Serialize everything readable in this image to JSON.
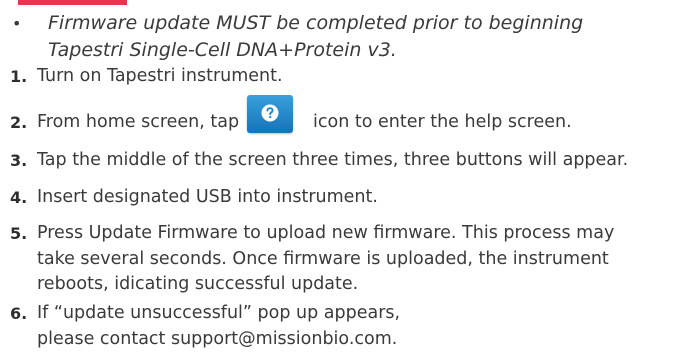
{
  "note": {
    "bullet": "•",
    "text": "Firmware update MUST be completed prior to beginning\nTapestri Single-Cell DNA+Protein v3."
  },
  "steps": [
    {
      "num": "1.",
      "text": "Turn on Tapestri instrument."
    },
    {
      "num": "2.",
      "text_before": "From home screen, tap",
      "icon": "help-question-icon",
      "text_after": "icon to enter the help screen."
    },
    {
      "num": "3.",
      "text": "Tap the middle of the screen three times, three buttons will appear."
    },
    {
      "num": "4.",
      "text": "Insert designated USB into instrument."
    },
    {
      "num": "5.",
      "text": "Press Update Firmware to upload new firmware. This process may\ntake several seconds. Once firmware is uploaded, the instrument\nreboots, idicating successful update."
    },
    {
      "num": "6.",
      "text": "If “update unsuccessful” pop up appears,\nplease contact support@missionbio.com."
    }
  ],
  "colors": {
    "accent": "#e8344e",
    "icon_blue": "#1f86cc"
  }
}
